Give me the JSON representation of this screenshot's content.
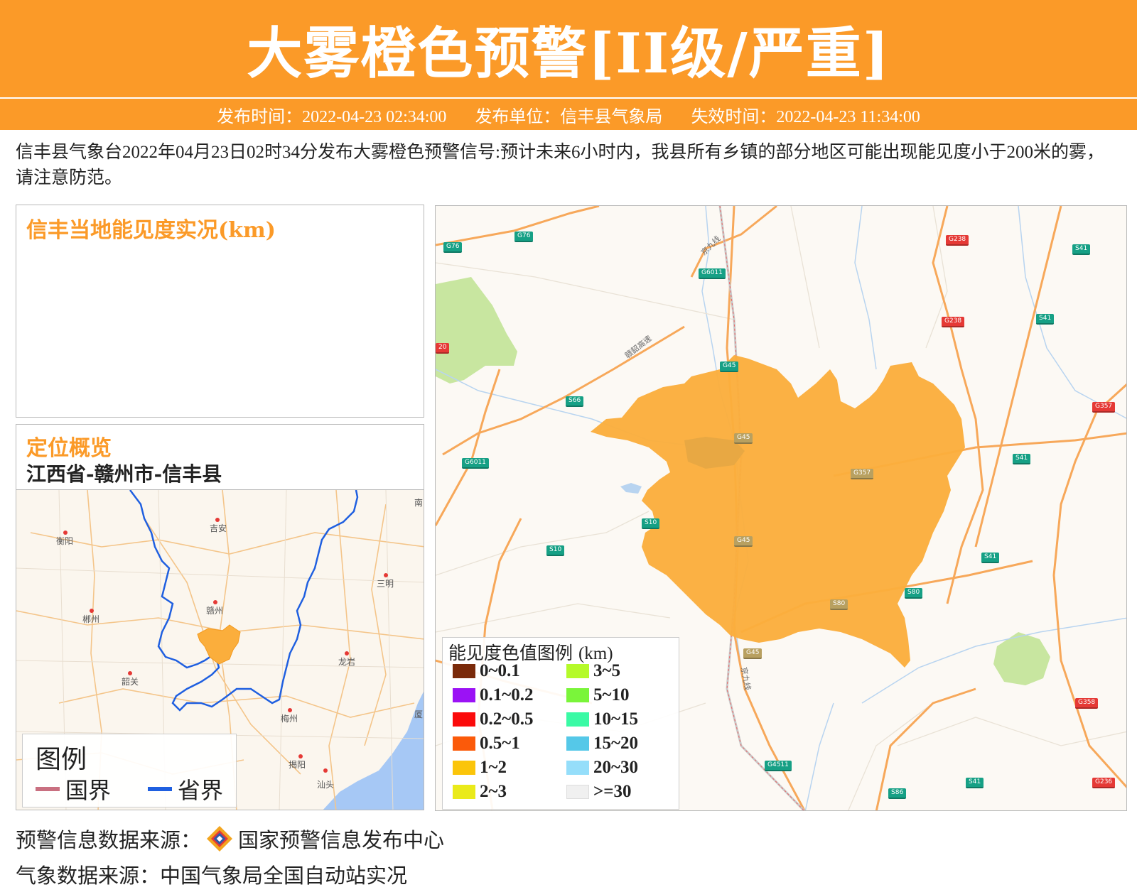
{
  "header": {
    "title": "大雾橙色预警[II级/严重]",
    "publish_time": "发布时间：2022-04-23 02:34:00",
    "publisher": "发布单位：信丰县气象局",
    "expire_time": "失效时间：2022-04-23 11:34:00"
  },
  "description": "信丰县气象台2022年04月23日02时34分发布大雾橙色预警信号:预计未来6小时内，我县所有乡镇的部分地区可能出现能见度小于200米的雾，请注意防范。",
  "visibility_panel": {
    "title": "信丰当地能见度实况(km)"
  },
  "location_panel": {
    "title": "定位概览",
    "region": "江西省-赣州市-信丰县"
  },
  "overview_map": {
    "cities": [
      "吉安",
      "衡阳",
      "三明",
      "郴州",
      "赣州",
      "龙岩",
      "韶关",
      "梅州",
      "揭阳",
      "汕头",
      "南",
      "厦"
    ],
    "legend": {
      "title": "图例",
      "national": "国界",
      "provincial": "省界",
      "national_color": "#c97080",
      "provincial_color": "#1f5fe0"
    },
    "highlight_color": "#fbae3c"
  },
  "main_map": {
    "road_labels": [
      "G76",
      "G76",
      "G6011",
      "G238",
      "S41",
      "G238",
      "S41",
      "G45",
      "S66",
      "G357",
      "G6011",
      "G45",
      "G357",
      "S41",
      "S10",
      "S10",
      "G45",
      "S41",
      "S80",
      "S80",
      "G45",
      "G358",
      "G4511",
      "S41",
      "S86",
      "G236",
      "20"
    ],
    "rail_labels": [
      "京九线",
      "赣韶高速",
      "京九线"
    ],
    "area_color": "#fbae3c"
  },
  "legend": {
    "title": "能见度色值图例",
    "unit": "(km)",
    "items": [
      {
        "label": "0~0.1",
        "color": "#7a2a0a"
      },
      {
        "label": "0.1~0.2",
        "color": "#9b12f5"
      },
      {
        "label": "0.2~0.5",
        "color": "#fb0a0a"
      },
      {
        "label": "0.5~1",
        "color": "#fb5a0a"
      },
      {
        "label": "1~2",
        "color": "#fbc50a"
      },
      {
        "label": "2~3",
        "color": "#eaea1a"
      },
      {
        "label": "3~5",
        "color": "#b5fa2a"
      },
      {
        "label": "5~10",
        "color": "#7af53a"
      },
      {
        "label": "10~15",
        "color": "#3afaa5"
      },
      {
        "label": "15~20",
        "color": "#55c8e8"
      },
      {
        "label": "20~30",
        "color": "#95defa"
      },
      {
        "label": ">=30",
        "color": "#f0f0f0"
      }
    ]
  },
  "sources": {
    "warning_label": "预警信息数据来源：",
    "warning_source": "国家预警信息发布中心",
    "weather": "气象数据来源：中国气象局全国自动站实况"
  }
}
